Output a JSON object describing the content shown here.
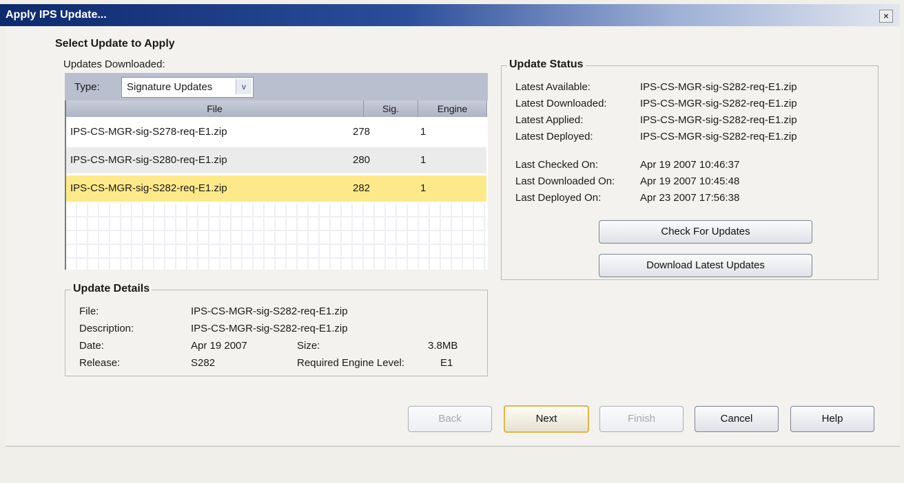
{
  "window": {
    "title": "Apply IPS Update...",
    "close_glyph": "×",
    "colors": {
      "titlebar_start": "#0e2a6e",
      "titlebar_end": "#e2e6ef",
      "selected_row": "#fde98a"
    }
  },
  "select_update": {
    "heading": "Select Update to Apply",
    "downloaded_label": "Updates Downloaded:",
    "type_label": "Type:",
    "type_value": "Signature Updates",
    "dropdown_glyph": "v",
    "columns": [
      "File",
      "Sig.",
      "Engine"
    ],
    "rows": [
      {
        "file": "IPS-CS-MGR-sig-S278-req-E1.zip",
        "sig": "278",
        "engine": "1",
        "selected": false
      },
      {
        "file": "IPS-CS-MGR-sig-S280-req-E1.zip",
        "sig": "280",
        "engine": "1",
        "selected": false
      },
      {
        "file": "IPS-CS-MGR-sig-S282-req-E1.zip",
        "sig": "282",
        "engine": "1",
        "selected": true
      }
    ]
  },
  "update_status": {
    "heading": "Update Status",
    "items": [
      {
        "label": "Latest Available:",
        "value": "IPS-CS-MGR-sig-S282-req-E1.zip"
      },
      {
        "label": "Latest Downloaded:",
        "value": "IPS-CS-MGR-sig-S282-req-E1.zip"
      },
      {
        "label": "Latest Applied:",
        "value": "IPS-CS-MGR-sig-S282-req-E1.zip"
      },
      {
        "label": "Latest Deployed:",
        "value": "IPS-CS-MGR-sig-S282-req-E1.zip"
      },
      {
        "label": "Last Checked On:",
        "value": "Apr 19 2007 10:46:37"
      },
      {
        "label": "Last Downloaded On:",
        "value": "Apr 19 2007 10:45:48"
      },
      {
        "label": "Last Deployed On:",
        "value": "Apr 23 2007 17:56:38"
      }
    ],
    "check_button": "Check For Updates",
    "download_button": "Download Latest Updates"
  },
  "update_details": {
    "heading": "Update Details",
    "file_label": "File:",
    "file_value": "IPS-CS-MGR-sig-S282-req-E1.zip",
    "description_label": "Description:",
    "description_value": "IPS-CS-MGR-sig-S282-req-E1.zip",
    "date_label": "Date:",
    "date_value": "Apr 19 2007",
    "size_label": "Size:",
    "size_value": "3.8MB",
    "release_label": "Release:",
    "release_value": "S282",
    "engine_level_label": "Required Engine Level:",
    "engine_level_value": "E1"
  },
  "buttons": {
    "back": "Back",
    "next": "Next",
    "finish": "Finish",
    "cancel": "Cancel",
    "help": "Help"
  }
}
